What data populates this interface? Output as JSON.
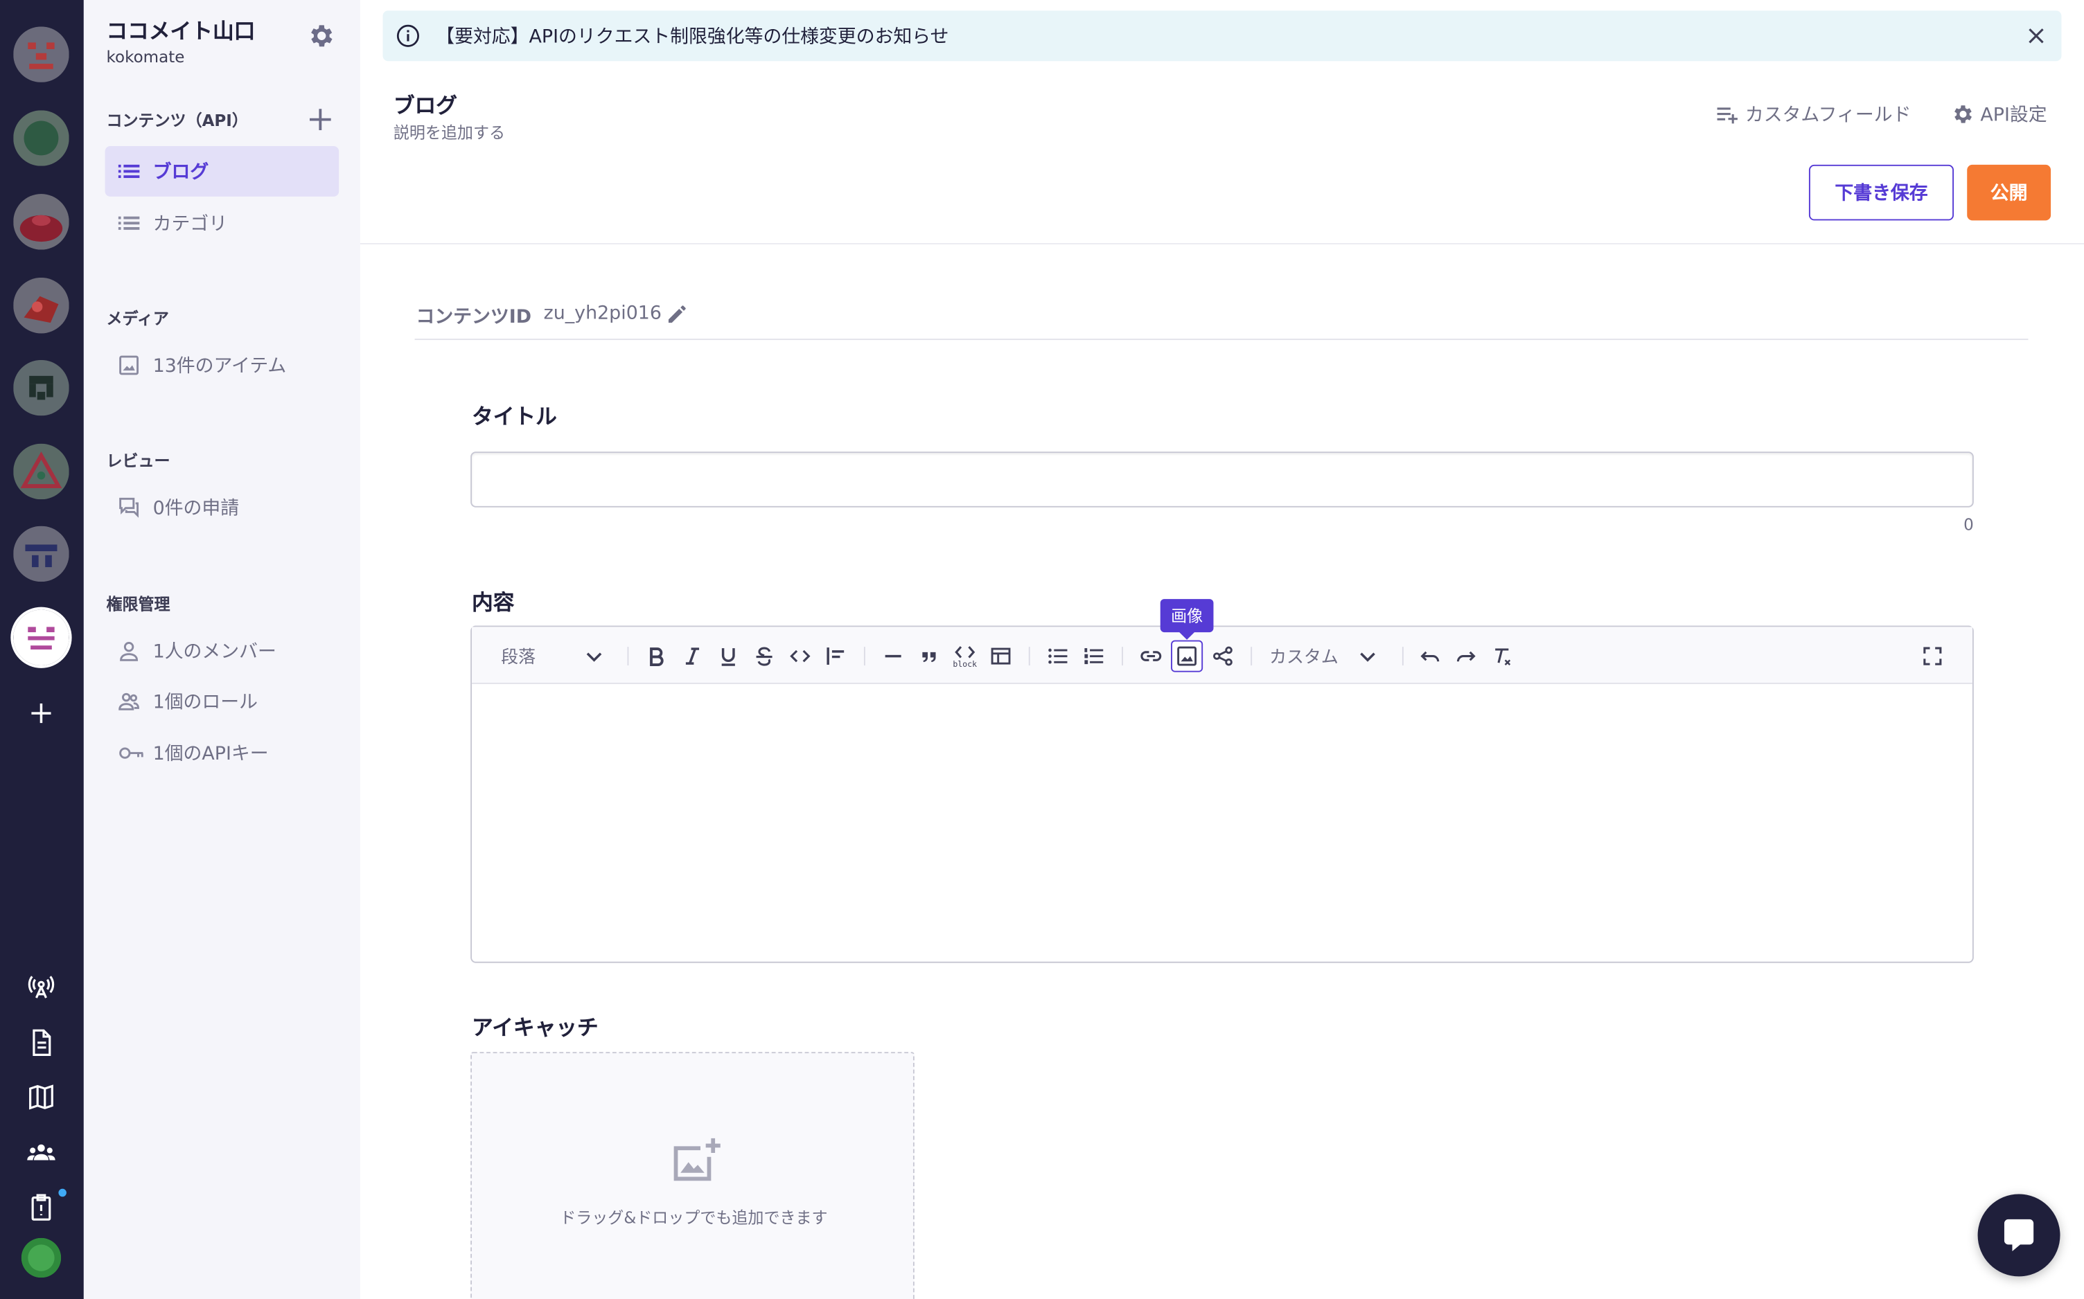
{
  "service": {
    "name": "ココメイト山口",
    "id": "kokomate"
  },
  "side_menu": {
    "content_section": "コンテンツ（API）",
    "apis": [
      {
        "label": "ブログ",
        "icon": "list-icon",
        "active": true
      },
      {
        "label": "カテゴリ",
        "icon": "list-icon",
        "active": false
      }
    ],
    "media_section": "メディア",
    "media_item": "13件のアイテム",
    "review_section": "レビュー",
    "review_item": "0件の申請",
    "permission_section": "権限管理",
    "permission_items": [
      {
        "label": "1人のメンバー",
        "icon": "person-icon"
      },
      {
        "label": "1個のロール",
        "icon": "group-icon"
      },
      {
        "label": "1個のAPIキー",
        "icon": "key-icon"
      }
    ]
  },
  "notice": {
    "text": "【要対応】APIのリクエスト制限強化等の仕様変更のお知らせ"
  },
  "header": {
    "title": "ブログ",
    "description": "説明を追加する",
    "custom_field_label": "カスタムフィールド",
    "api_settings_label": "API設定",
    "draft_button": "下書き保存",
    "publish_button": "公開"
  },
  "content_id": {
    "label": "コンテンツID",
    "value": "zu_yh2pi016"
  },
  "fields": {
    "title_label": "タイトル",
    "title_value": "",
    "title_count": "0",
    "body_label": "内容",
    "eyecatch_label": "アイキャッチ",
    "dropzone_text": "ドラッグ&ドロップでも追加できます"
  },
  "toolbar": {
    "paragraph_select": "段落",
    "custom_select": "カスタム",
    "tooltip": "画像",
    "code_block_caption": "block"
  },
  "colors": {
    "accent": "#563bd5",
    "publish": "#f57a33",
    "rail": "#1f1f3b",
    "notice_bg": "#e8f5f9"
  }
}
